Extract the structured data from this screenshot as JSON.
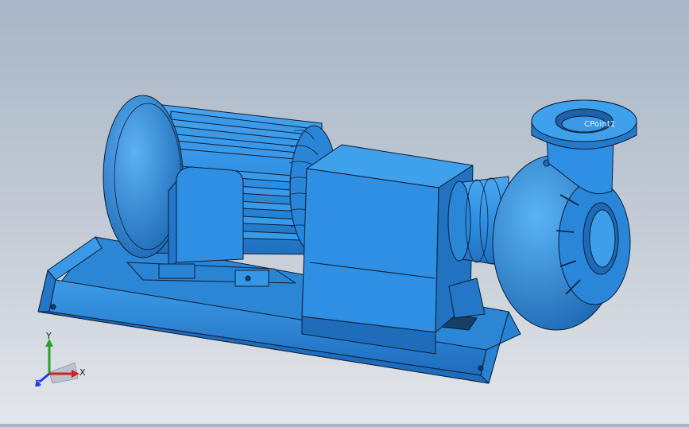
{
  "view": {
    "reference_point_label": "CPoint1",
    "model_color": "#2f8fe3",
    "edge_color": "#0b1d33",
    "background_top": "#a9b6c7",
    "background_bottom": "#e4e7eb"
  },
  "triad": {
    "x_label": "X",
    "y_label": "Y",
    "z_label": "Z",
    "x_color": "#d32020",
    "y_color": "#2ca02c",
    "z_color": "#1f3fd1"
  }
}
